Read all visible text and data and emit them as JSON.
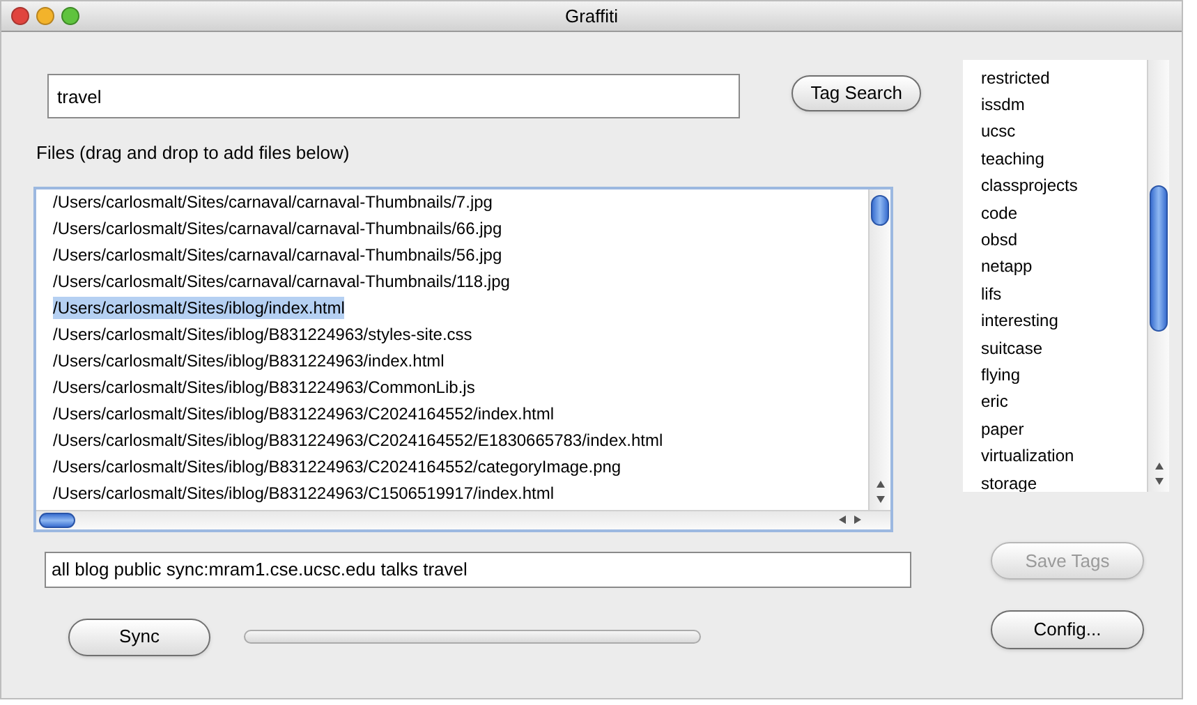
{
  "window": {
    "title": "Graffiti"
  },
  "search": {
    "value": "travel",
    "button": {
      "label": "Tag Search",
      "disabled": false
    }
  },
  "files_label": "Files (drag and drop to add files below)",
  "files": [
    {
      "path": "/Users/carlosmalt/Sites/carnaval/carnaval-Thumbnails/7.jpg",
      "selected": false
    },
    {
      "path": "/Users/carlosmalt/Sites/carnaval/carnaval-Thumbnails/66.jpg",
      "selected": false
    },
    {
      "path": "/Users/carlosmalt/Sites/carnaval/carnaval-Thumbnails/56.jpg",
      "selected": false
    },
    {
      "path": "/Users/carlosmalt/Sites/carnaval/carnaval-Thumbnails/118.jpg",
      "selected": false
    },
    {
      "path": "/Users/carlosmalt/Sites/iblog/index.html",
      "selected": true
    },
    {
      "path": "/Users/carlosmalt/Sites/iblog/B831224963/styles-site.css",
      "selected": false
    },
    {
      "path": "/Users/carlosmalt/Sites/iblog/B831224963/index.html",
      "selected": false
    },
    {
      "path": "/Users/carlosmalt/Sites/iblog/B831224963/CommonLib.js",
      "selected": false
    },
    {
      "path": "/Users/carlosmalt/Sites/iblog/B831224963/C2024164552/index.html",
      "selected": false
    },
    {
      "path": "/Users/carlosmalt/Sites/iblog/B831224963/C2024164552/E1830665783/index.html",
      "selected": false
    },
    {
      "path": "/Users/carlosmalt/Sites/iblog/B831224963/C2024164552/categoryImage.png",
      "selected": false
    },
    {
      "path": "/Users/carlosmalt/Sites/iblog/B831224963/C1506519917/index.html",
      "selected": false
    }
  ],
  "tags_field": {
    "value": "all blog public sync:mram1.cse.ucsc.edu talks travel"
  },
  "tags": [
    "restricted",
    "issdm",
    "ucsc",
    "teaching",
    "classprojects",
    "code",
    "obsd",
    "netapp",
    "lifs",
    "interesting",
    "suitcase",
    "flying",
    "eric",
    "paper",
    "virtualization",
    "storage"
  ],
  "save_button": {
    "label": "Save Tags",
    "disabled": true
  },
  "sync_button": {
    "label": "Sync",
    "disabled": false
  },
  "progress": {
    "level": 0
  },
  "config_button": {
    "label": "Config...",
    "disabled": false
  }
}
